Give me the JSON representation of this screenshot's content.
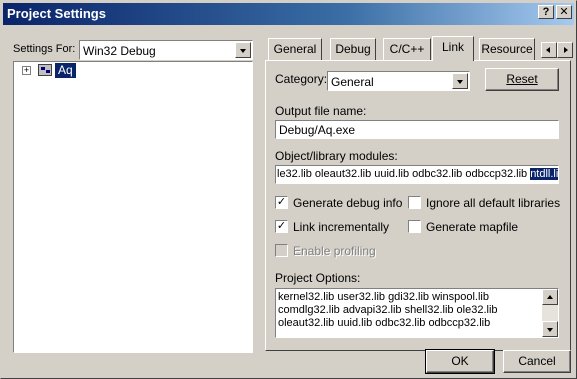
{
  "window": {
    "title": "Project Settings",
    "help_label": "?",
    "close_label": "✕"
  },
  "left": {
    "settings_for_label": "Settings For:",
    "settings_for_value": "Win32 Debug",
    "tree": {
      "expander": "+",
      "item_label": "Aq"
    }
  },
  "tabs": [
    {
      "label": "General"
    },
    {
      "label": "Debug"
    },
    {
      "label": "C/C++"
    },
    {
      "label": "Link"
    },
    {
      "label": "Resource"
    }
  ],
  "active_tab": "Link",
  "link": {
    "category_label": "Category:",
    "category_value": "General",
    "reset_label": "Reset",
    "output_label": "Output file name:",
    "output_value": "Debug/Aq.exe",
    "modules_label": "Object/library modules:",
    "modules_value_plain": "le32.lib oleaut32.lib uuid.lib odbc32.lib odbccp32.lib ",
    "modules_value_selected": "ntdll.lib",
    "checks": {
      "generate_debug_info": {
        "label": "Generate debug info",
        "checked": true
      },
      "ignore_default_libs": {
        "label": "Ignore all default libraries",
        "checked": false
      },
      "link_incrementally": {
        "label": "Link incrementally",
        "checked": true
      },
      "generate_mapfile": {
        "label": "Generate mapfile",
        "checked": false
      },
      "enable_profiling": {
        "label": "Enable profiling",
        "checked": false,
        "disabled": true
      }
    },
    "project_options_label": "Project Options:",
    "project_options_lines": [
      "kernel32.lib user32.lib gdi32.lib winspool.lib",
      "comdlg32.lib advapi32.lib shell32.lib ole32.lib",
      "oleaut32.lib uuid.lib odbc32.lib odbccp32.lib"
    ]
  },
  "footer": {
    "ok_label": "OK",
    "cancel_label": "Cancel"
  },
  "colors": {
    "title_gradient_start": "#0a246a",
    "title_gradient_end": "#a6caf0",
    "selection": "#0a246a",
    "face": "#d4d0c8"
  }
}
